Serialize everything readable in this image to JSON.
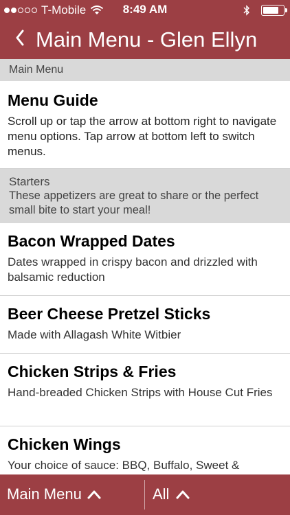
{
  "status_bar": {
    "carrier": "T-Mobile",
    "time": "8:49 AM"
  },
  "nav": {
    "title": "Main Menu - Glen Ellyn",
    "back_icon": "chevron-left-icon"
  },
  "sections": {
    "main_menu_header": "Main Menu",
    "menu_guide": {
      "title": "Menu Guide",
      "description": "Scroll up or tap the arrow at bottom right to navigate menu options. Tap arrow at bottom left to switch menus."
    },
    "starters": {
      "title": "Starters",
      "description": "These appetizers are great to share or the perfect small bite to start your meal!"
    }
  },
  "items": [
    {
      "title": "Bacon Wrapped Dates",
      "description": "Dates wrapped in crispy bacon and drizzled with balsamic reduction"
    },
    {
      "title": "Beer Cheese Pretzel Sticks",
      "description": "Made with Allagash White Witbier"
    },
    {
      "title": "Chicken Strips & Fries",
      "description": "Hand-breaded Chicken Strips with House Cut Fries"
    },
    {
      "title": "Chicken Wings",
      "description": "Your choice of sauce: BBQ, Buffalo, Sweet &"
    }
  ],
  "bottom_bar": {
    "menu_label": "Main Menu",
    "category_label": "All"
  },
  "colors": {
    "brand": "#9c3f44",
    "section_bg": "#d9d9d9"
  }
}
